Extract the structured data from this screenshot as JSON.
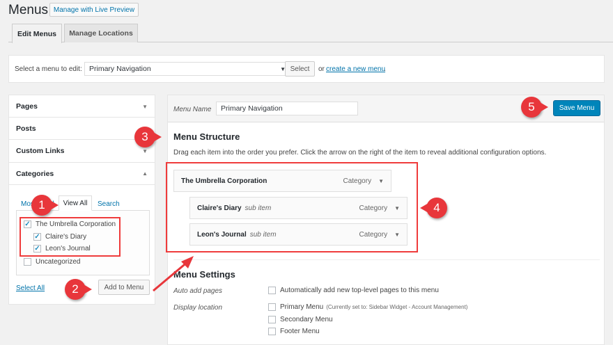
{
  "header": {
    "title": "Menus",
    "live_preview": "Manage with Live Preview"
  },
  "tabs": [
    {
      "label": "Edit Menus",
      "active": true
    },
    {
      "label": "Manage Locations",
      "active": false
    }
  ],
  "select_bar": {
    "label": "Select a menu to edit:",
    "value": "Primary Navigation",
    "select_btn": "Select",
    "or": "or",
    "create_link": "create a new menu",
    "period": "."
  },
  "sidebar": {
    "sections": [
      {
        "label": "Pages"
      },
      {
        "label": "Posts"
      },
      {
        "label": "Custom Links"
      },
      {
        "label": "Categories"
      }
    ],
    "category_tabs": [
      "Most Used",
      "View All",
      "Search"
    ],
    "categories": [
      {
        "label": "The Umbrella Corporation",
        "checked": true
      },
      {
        "label": "Claire's Diary",
        "checked": true
      },
      {
        "label": "Leon's Journal",
        "checked": true
      },
      {
        "label": "Uncategorized",
        "checked": false
      }
    ],
    "select_all": "Select All",
    "add_to_menu": "Add to Menu"
  },
  "editor": {
    "menu_name_label": "Menu Name",
    "menu_name_value": "Primary Navigation",
    "save": "Save Menu",
    "structure_title": "Menu Structure",
    "structure_desc": "Drag each item into the order you prefer. Click the arrow on the right of the item to reveal additional configuration options.",
    "items": [
      {
        "title": "The Umbrella Corporation",
        "sub": "",
        "type": "Category"
      },
      {
        "title": "Claire's Diary",
        "sub": "sub item",
        "type": "Category"
      },
      {
        "title": "Leon's Journal",
        "sub": "sub item",
        "type": "Category"
      }
    ],
    "settings_title": "Menu Settings",
    "auto_add_label": "Auto add pages",
    "auto_add_option": "Automatically add new top-level pages to this menu",
    "display_label": "Display location",
    "locations": [
      {
        "label": "Primary Menu",
        "note": "(Currently set to: Sidebar Widget - Account Management)"
      },
      {
        "label": "Secondary Menu",
        "note": ""
      },
      {
        "label": "Footer Menu",
        "note": ""
      }
    ]
  },
  "callouts": [
    "1",
    "2",
    "3",
    "4",
    "5"
  ],
  "colors": {
    "accent": "#0073aa",
    "primary_button": "#0085ba",
    "callout": "#e8363b"
  }
}
